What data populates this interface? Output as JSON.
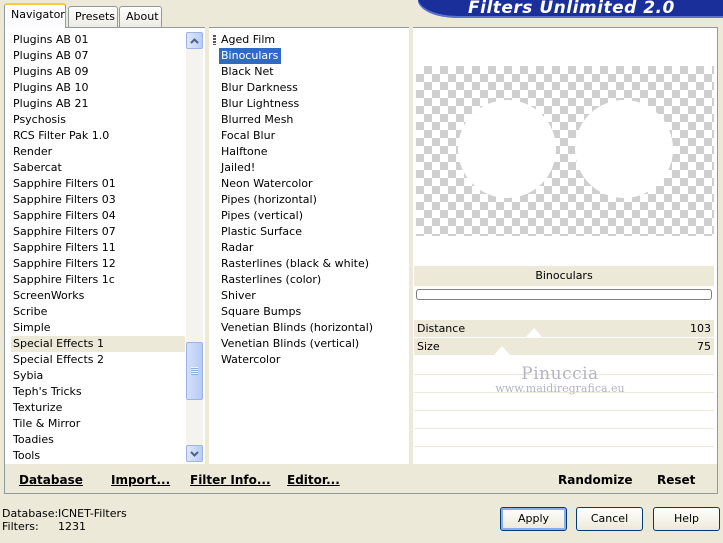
{
  "tabs": [
    "Navigator",
    "Presets",
    "About"
  ],
  "banner_title": "Filters Unlimited 2.0",
  "categories": [
    "Plugins AB 01",
    "Plugins AB 07",
    "Plugins AB 09",
    "Plugins AB 10",
    "Plugins AB 21",
    "Psychosis",
    "RCS Filter Pak 1.0",
    "Render",
    "Sabercat",
    "Sapphire Filters 01",
    "Sapphire Filters 03",
    "Sapphire Filters 04",
    "Sapphire Filters 07",
    "Sapphire Filters 11",
    "Sapphire Filters 12",
    "Sapphire Filters 1c",
    "ScreenWorks",
    "Scribe",
    "Simple",
    "Special Effects 1",
    "Special Effects 2",
    "Sybia",
    "Teph's Tricks",
    "Texturize",
    "Tile & Mirror",
    "Toadies",
    "Tools"
  ],
  "selected_category": "Special Effects 1",
  "filters": [
    "Aged Film",
    "Binoculars",
    "Black Net",
    "Blur Darkness",
    "Blur Lightness",
    "Blurred Mesh",
    "Focal Blur",
    "Halftone",
    "Jailed!",
    "Neon Watercolor",
    "Pipes (horizontal)",
    "Pipes (vertical)",
    "Plastic Surface",
    "Radar",
    "Rasterlines (black & white)",
    "Rasterlines (color)",
    "Shiver",
    "Square Bumps",
    "Venetian Blinds (horizontal)",
    "Venetian Blinds (vertical)",
    "Watercolor"
  ],
  "selected_filter": "Binoculars",
  "preview": {
    "filter_name": "Binoculars"
  },
  "params": [
    {
      "name": "Distance",
      "value": "103"
    },
    {
      "name": "Size",
      "value": "75"
    }
  ],
  "watermark": {
    "line1": "Pinuccia",
    "line2": "www.maidiregrafica.eu"
  },
  "toolbar": {
    "database": "Database",
    "import": "Import...",
    "filter_info": "Filter Info...",
    "editor": "Editor...",
    "randomize": "Randomize",
    "reset": "Reset"
  },
  "status": {
    "database_label": "Database:",
    "database_value": "ICNET-Filters",
    "filters_label": "Filters:",
    "filters_value": "1231"
  },
  "buttons": {
    "apply": "Apply",
    "cancel": "Cancel",
    "help": "Help"
  },
  "colors": {
    "selection": "#316ac5",
    "banner": "#1a2f9a",
    "panel": "#ece9d8"
  }
}
